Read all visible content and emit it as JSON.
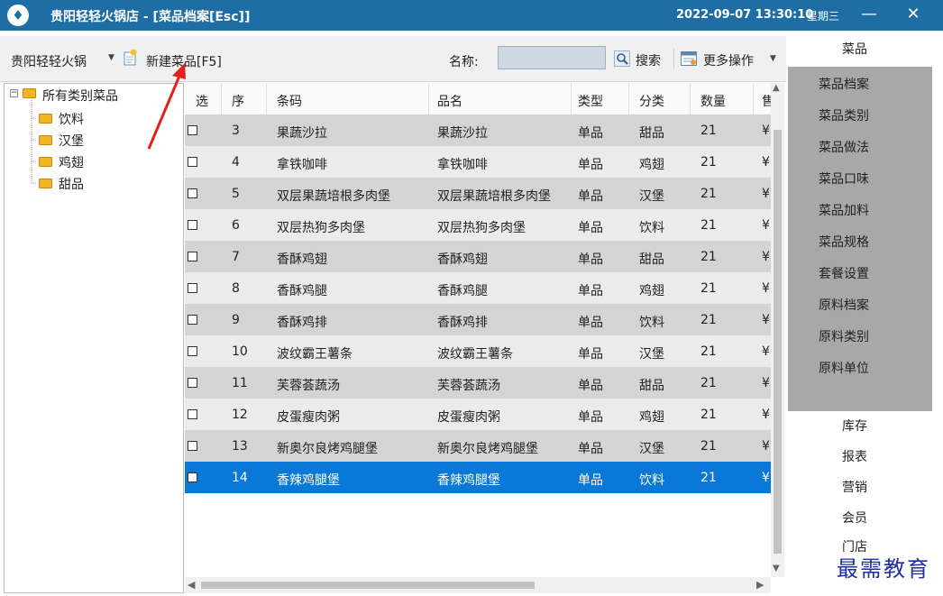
{
  "window": {
    "title": "贵阳轻轻火锅店 - [菜品档案[Esc]]",
    "datetime": "2022-09-07 13:30:10",
    "weekday": "星期三",
    "minimize_glyph": "—",
    "close_glyph": "✕"
  },
  "toolbar": {
    "store_value": "贵阳轻轻火锅",
    "new_dish_label": "新建菜品[F5]",
    "name_label": "名称:",
    "name_value": "",
    "search_label": "搜索",
    "more_label": "更多操作"
  },
  "tree": {
    "root": "所有类别菜品",
    "children": [
      "饮料",
      "汉堡",
      "鸡翅",
      "甜品"
    ]
  },
  "grid": {
    "columns": [
      "选",
      "序",
      "条码",
      "品名",
      "类型",
      "分类",
      "数量",
      "售"
    ],
    "rows": [
      {
        "seq": "3",
        "barcode": "果蔬沙拉",
        "name": "果蔬沙拉",
        "type": "单品",
        "category": "甜品",
        "qty": "21",
        "price": "¥",
        "checked": false,
        "selected": false
      },
      {
        "seq": "4",
        "barcode": "拿铁咖啡",
        "name": "拿铁咖啡",
        "type": "单品",
        "category": "鸡翅",
        "qty": "21",
        "price": "¥",
        "checked": false,
        "selected": false
      },
      {
        "seq": "5",
        "barcode": "双层果蔬培根多肉堡",
        "name": "双层果蔬培根多肉堡",
        "type": "单品",
        "category": "汉堡",
        "qty": "21",
        "price": "¥",
        "checked": false,
        "selected": false
      },
      {
        "seq": "6",
        "barcode": "双层热狗多肉堡",
        "name": "双层热狗多肉堡",
        "type": "单品",
        "category": "饮料",
        "qty": "21",
        "price": "¥",
        "checked": false,
        "selected": false
      },
      {
        "seq": "7",
        "barcode": "香酥鸡翅",
        "name": "香酥鸡翅",
        "type": "单品",
        "category": "甜品",
        "qty": "21",
        "price": "¥",
        "checked": false,
        "selected": false
      },
      {
        "seq": "8",
        "barcode": "香酥鸡腿",
        "name": "香酥鸡腿",
        "type": "单品",
        "category": "鸡翅",
        "qty": "21",
        "price": "¥",
        "checked": false,
        "selected": false
      },
      {
        "seq": "9",
        "barcode": "香酥鸡排",
        "name": "香酥鸡排",
        "type": "单品",
        "category": "饮料",
        "qty": "21",
        "price": "¥",
        "checked": false,
        "selected": false
      },
      {
        "seq": "10",
        "barcode": "波纹霸王薯条",
        "name": "波纹霸王薯条",
        "type": "单品",
        "category": "汉堡",
        "qty": "21",
        "price": "¥",
        "checked": false,
        "selected": false
      },
      {
        "seq": "11",
        "barcode": "芙蓉荟蔬汤",
        "name": "芙蓉荟蔬汤",
        "type": "单品",
        "category": "甜品",
        "qty": "21",
        "price": "¥",
        "checked": false,
        "selected": false
      },
      {
        "seq": "12",
        "barcode": "皮蛋瘦肉粥",
        "name": "皮蛋瘦肉粥",
        "type": "单品",
        "category": "鸡翅",
        "qty": "21",
        "price": "¥",
        "checked": false,
        "selected": false
      },
      {
        "seq": "13",
        "barcode": "新奥尔良烤鸡腿堡",
        "name": "新奥尔良烤鸡腿堡",
        "type": "单品",
        "category": "汉堡",
        "qty": "21",
        "price": "¥",
        "checked": false,
        "selected": false
      },
      {
        "seq": "14",
        "barcode": "香辣鸡腿堡",
        "name": "香辣鸡腿堡",
        "type": "单品",
        "category": "饮料",
        "qty": "21",
        "price": "¥",
        "checked": false,
        "selected": true
      }
    ]
  },
  "rightnav": {
    "top_item": "菜品",
    "submenu": [
      "菜品档案",
      "菜品类别",
      "菜品做法",
      "菜品口味",
      "菜品加料",
      "菜品规格",
      "套餐设置",
      "原料档案",
      "原料类别",
      "原料单位"
    ],
    "items": [
      "库存",
      "报表",
      "营销",
      "会员",
      "门店"
    ]
  },
  "watermark": "最需教育",
  "colors": {
    "titlebar": "#1e6ea5",
    "row_dark": "#d4d4d4",
    "row_light": "#ebebeb",
    "row_selected": "#0a78d7",
    "submenu_bg": "#a8a8a8",
    "annotation_arrow": "#e0201b",
    "watermark": "#1f2ea0"
  },
  "icons": {
    "app": "app-logo-icon",
    "new": "new-dish-icon",
    "search": "magnifier-icon",
    "more": "more-operations-icon",
    "folder": "folder-icon",
    "annotation": "red-arrow-icon"
  }
}
